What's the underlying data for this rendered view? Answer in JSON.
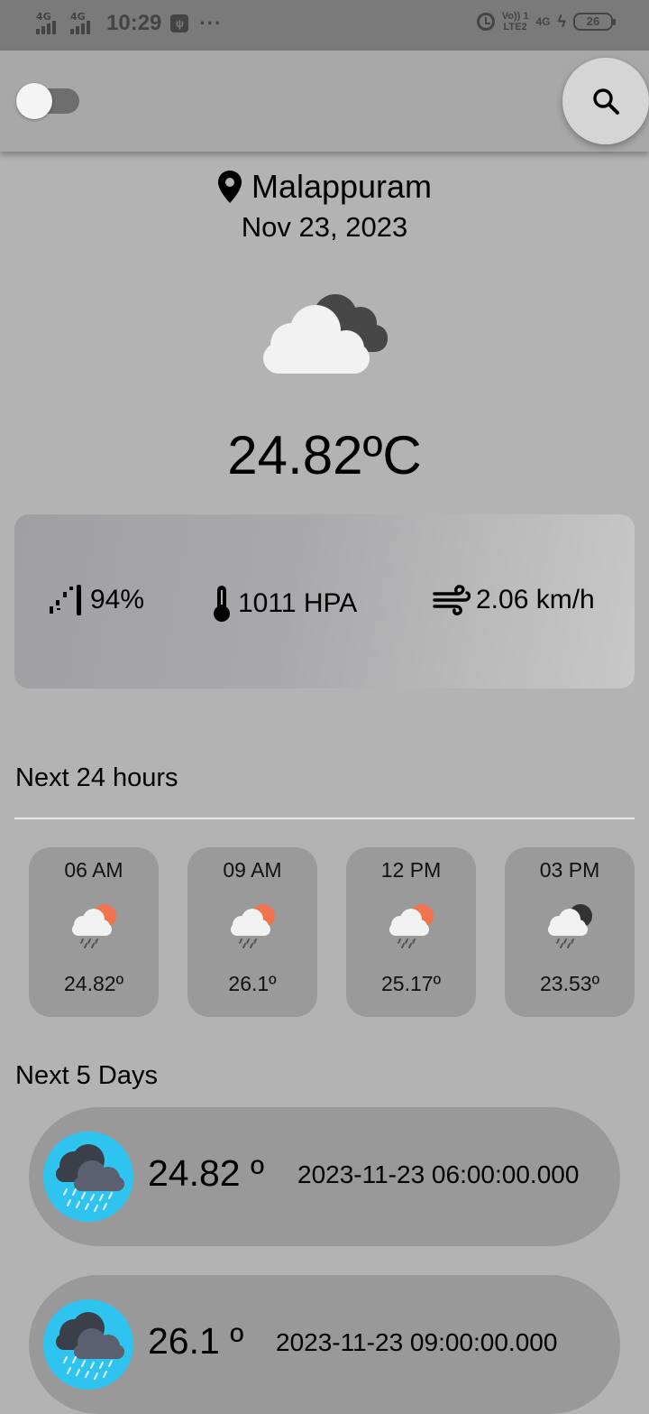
{
  "status_bar": {
    "signal1": "4G",
    "signal2": "4G",
    "time": "10:29",
    "usb_icon": "usb-debug-icon",
    "dots": "···",
    "alarm_icon": "alarm-icon",
    "volte_top": "Vo)) 1",
    "volte_bottom": "LTE2",
    "network": "4G",
    "battery": "26"
  },
  "app_bar": {
    "toggle_state": "off",
    "search_icon": "search-icon"
  },
  "location": {
    "icon": "location-pin-icon",
    "city": "Malappuram",
    "date": "Nov 23, 2023"
  },
  "current": {
    "icon": "cloudy-icon",
    "temperature": "24.82ºC"
  },
  "details": {
    "humidity": "94%",
    "pressure": "1011 HPA",
    "wind": "2.06 km/h"
  },
  "hourly": {
    "title": "Next 24 hours",
    "items": [
      {
        "time": "06 AM",
        "temp": "24.82º",
        "icon": "rain-sun-icon"
      },
      {
        "time": "09 AM",
        "temp": "26.1º",
        "icon": "rain-sun-icon"
      },
      {
        "time": "12 PM",
        "temp": "25.17º",
        "icon": "rain-sun-icon"
      },
      {
        "time": "03 PM",
        "temp": "23.53º",
        "icon": "rain-moon-icon"
      }
    ]
  },
  "daily": {
    "title": "Next 5 Days",
    "items": [
      {
        "temp": "24.82 º",
        "datetime": "2023-11-23 06:00:00.000",
        "icon": "heavy-rain-icon"
      },
      {
        "temp": "26.1 º",
        "datetime": "2023-11-23 09:00:00.000",
        "icon": "heavy-rain-icon"
      }
    ]
  },
  "colors": {
    "background": "#b3b3b3",
    "sun": "#ee7550",
    "day_icon_bg": "#2fc4f0"
  }
}
